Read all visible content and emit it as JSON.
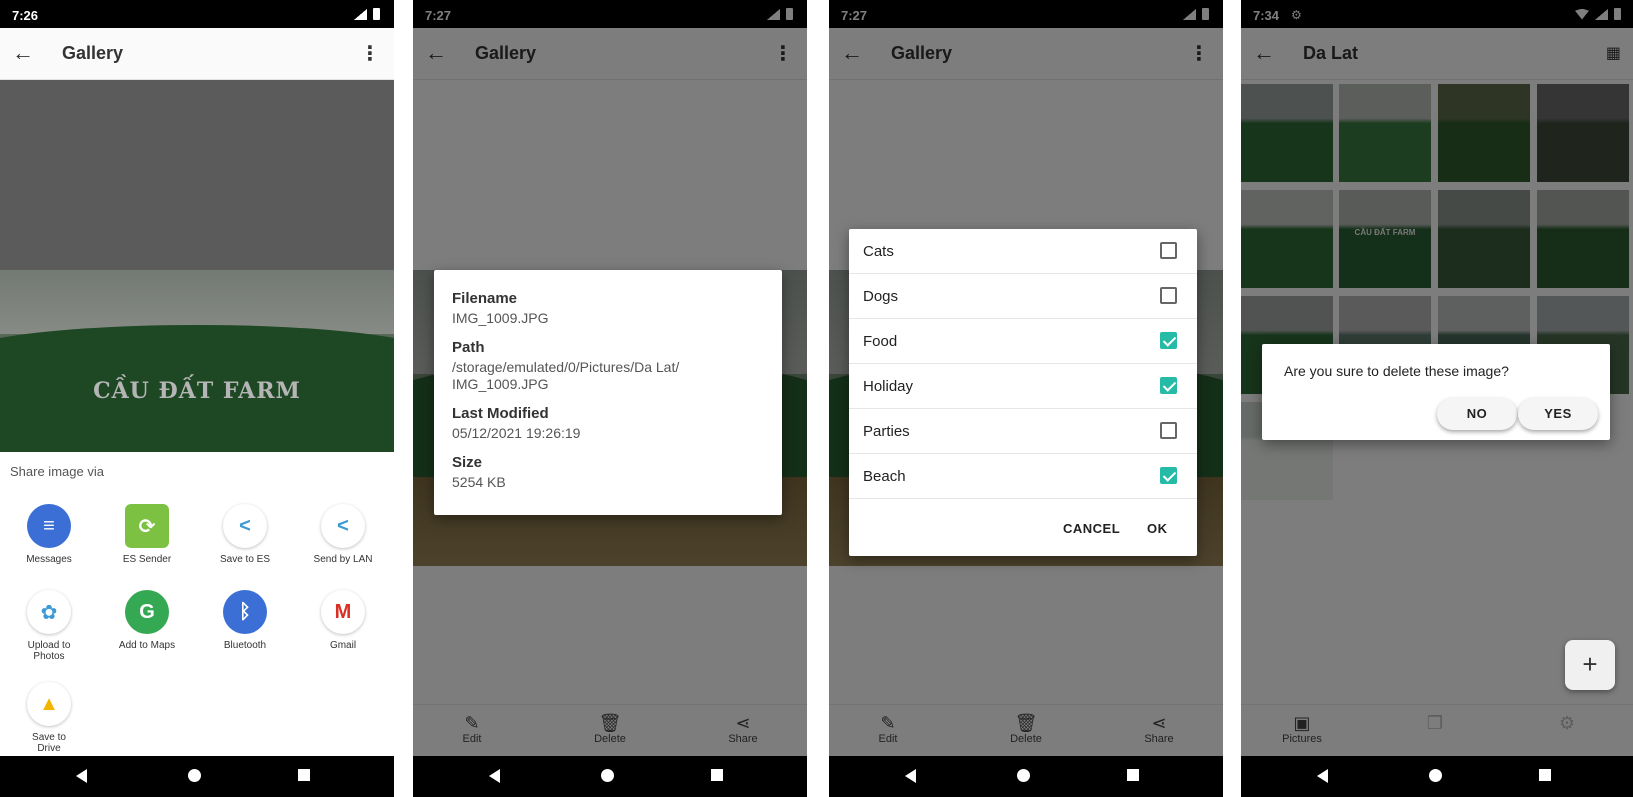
{
  "screen1": {
    "status_time": "7:26",
    "title": "Gallery",
    "photo_text": "CẦU ĐẤT FARM",
    "share_title": "Share image via",
    "apps": [
      {
        "label": "Messages",
        "icon": "messages-icon",
        "color": "#3b6fd6",
        "glyph": "≡"
      },
      {
        "label": "ES Sender",
        "icon": "es-sender-icon",
        "color": "#7cc142",
        "glyph": "⟳"
      },
      {
        "label": "Save to ES",
        "icon": "share-es-icon",
        "color": "#ffffff",
        "glyph": "<"
      },
      {
        "label": "Send by LAN",
        "icon": "share-lan-icon",
        "color": "#ffffff",
        "glyph": "<"
      },
      {
        "label": "Upload to Photos",
        "icon": "google-photos-icon",
        "color": "#ffffff",
        "glyph": "✿"
      },
      {
        "label": "Add to Maps",
        "icon": "google-maps-icon",
        "color": "#34a853",
        "glyph": "G"
      },
      {
        "label": "Bluetooth",
        "icon": "bluetooth-icon",
        "color": "#3b6fd6",
        "glyph": "ᛒ"
      },
      {
        "label": "Gmail",
        "icon": "gmail-icon",
        "color": "#ffffff",
        "glyph": "M"
      },
      {
        "label": "Save to Drive",
        "icon": "google-drive-icon",
        "color": "#ffffff",
        "glyph": "▲"
      }
    ]
  },
  "screen2": {
    "status_time": "7:27",
    "title": "Gallery",
    "details": {
      "filename_label": "Filename",
      "filename": "IMG_1009.JPG",
      "path_label": "Path",
      "path": "/storage/emulated/0/Pictures/Da Lat/\nIMG_1009.JPG",
      "modified_label": "Last Modified",
      "modified": "05/12/2021 19:26:19",
      "size_label": "Size",
      "size": "5254 KB"
    },
    "bottom": {
      "edit": "Edit",
      "delete": "Delete",
      "share": "Share"
    }
  },
  "screen3": {
    "status_time": "7:27",
    "title": "Gallery",
    "options": [
      {
        "label": "Cats",
        "checked": false
      },
      {
        "label": "Dogs",
        "checked": false
      },
      {
        "label": "Food",
        "checked": true
      },
      {
        "label": "Holiday",
        "checked": true
      },
      {
        "label": "Parties",
        "checked": false
      },
      {
        "label": "Beach",
        "checked": true
      }
    ],
    "cancel": "CANCEL",
    "ok": "OK",
    "bottom": {
      "edit": "Edit",
      "delete": "Delete",
      "share": "Share"
    }
  },
  "screen4": {
    "status_time": "7:34",
    "title": "Da Lat",
    "thumb_text": "CẦU ĐẤT FARM",
    "confirm_text": "Are you sure to delete these image?",
    "no": "NO",
    "yes": "YES",
    "fab": "+",
    "tabs": {
      "pictures": "Pictures"
    }
  },
  "colors": {
    "accent": "#26bba6",
    "scrim": "rgba(0,0,0,0.5)"
  }
}
